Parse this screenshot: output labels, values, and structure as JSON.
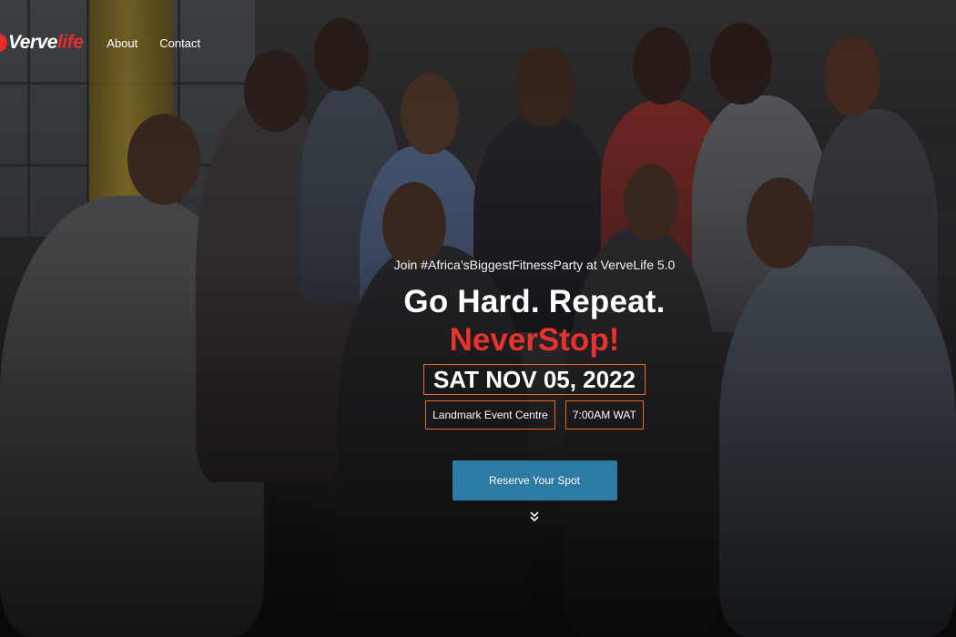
{
  "brand": {
    "logo_verve": "Verve",
    "logo_life": "life",
    "accent": "#e62b2b"
  },
  "nav": {
    "items": [
      {
        "label": "About"
      },
      {
        "label": "Contact"
      }
    ]
  },
  "hero": {
    "tagline": "Join #Africa’sBiggestFitnessParty at VerveLife 5.0",
    "headline": "Go Hard. Repeat.",
    "highlight": "NeverStop!",
    "highlight_color": "#e8322c",
    "date": "SAT NOV 05, 2022",
    "venue": "Landmark Event Centre",
    "time": "7:00AM WAT",
    "border_color": "#e36a2a",
    "cta_label": "Reserve Your Spot",
    "cta_color": "#2d7aa4",
    "scroll_icon": "chevron-double-down-icon"
  }
}
